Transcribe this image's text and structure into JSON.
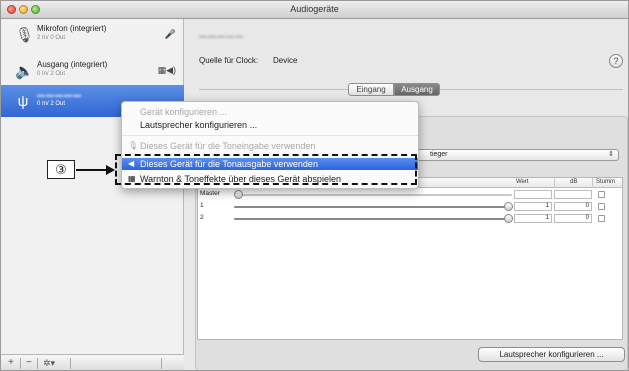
{
  "window": {
    "title": "Audiogeräte"
  },
  "sidebar": {
    "devices": [
      {
        "name": "Mikrofon (integriert)",
        "io": "2 In/ 0 Out",
        "icon": "microphone-icon",
        "right_icon": "mic-small-icon"
      },
      {
        "name": "Ausgang (integriert)",
        "io": "0 In/ 2 Out",
        "icon": "speaker-icon",
        "right_icon": "speaker-volume-icon"
      },
      {
        "name": "▬▬▬▬▬",
        "io": "0 In/ 2 Out",
        "icon": "usb-icon"
      }
    ],
    "add_label": "+",
    "remove_label": "−",
    "gear_label": "✲▾"
  },
  "main": {
    "device_name": "▬▬▬▬▬",
    "clock_label": "Quelle für Clock:",
    "clock_value": "Device",
    "help_label": "?",
    "tabs": {
      "input": "Eingang",
      "output": "Ausgang"
    },
    "format_value": "tieger",
    "table": {
      "headers": {
        "value": "Wert",
        "db": "dB",
        "mute": "Stumm"
      },
      "rows": [
        {
          "label": "Master",
          "value": "",
          "db": ""
        },
        {
          "label": "1",
          "value": "1",
          "db": "0"
        },
        {
          "label": "2",
          "value": "1",
          "db": "0"
        }
      ]
    },
    "configure_speakers_button": "Lautsprecher konfigurieren ..."
  },
  "context_menu": {
    "items": [
      {
        "label": "Gerät konfigurieren ...",
        "disabled": true
      },
      {
        "label": "Lautsprecher konfigurieren ...",
        "disabled": false
      },
      {
        "label": "Dieses Gerät für die Toneingabe verwenden",
        "disabled": true
      },
      {
        "label": "Dieses Gerät für die Tonausgabe verwenden",
        "selected": true
      },
      {
        "label": "Warnton & Toneffekte über dieses Gerät abspielen",
        "disabled": false
      }
    ]
  },
  "annotation": {
    "callout_number": "③"
  },
  "colors": {
    "selection": "#2f67d3",
    "menu_selected": "#3a6fe2"
  }
}
